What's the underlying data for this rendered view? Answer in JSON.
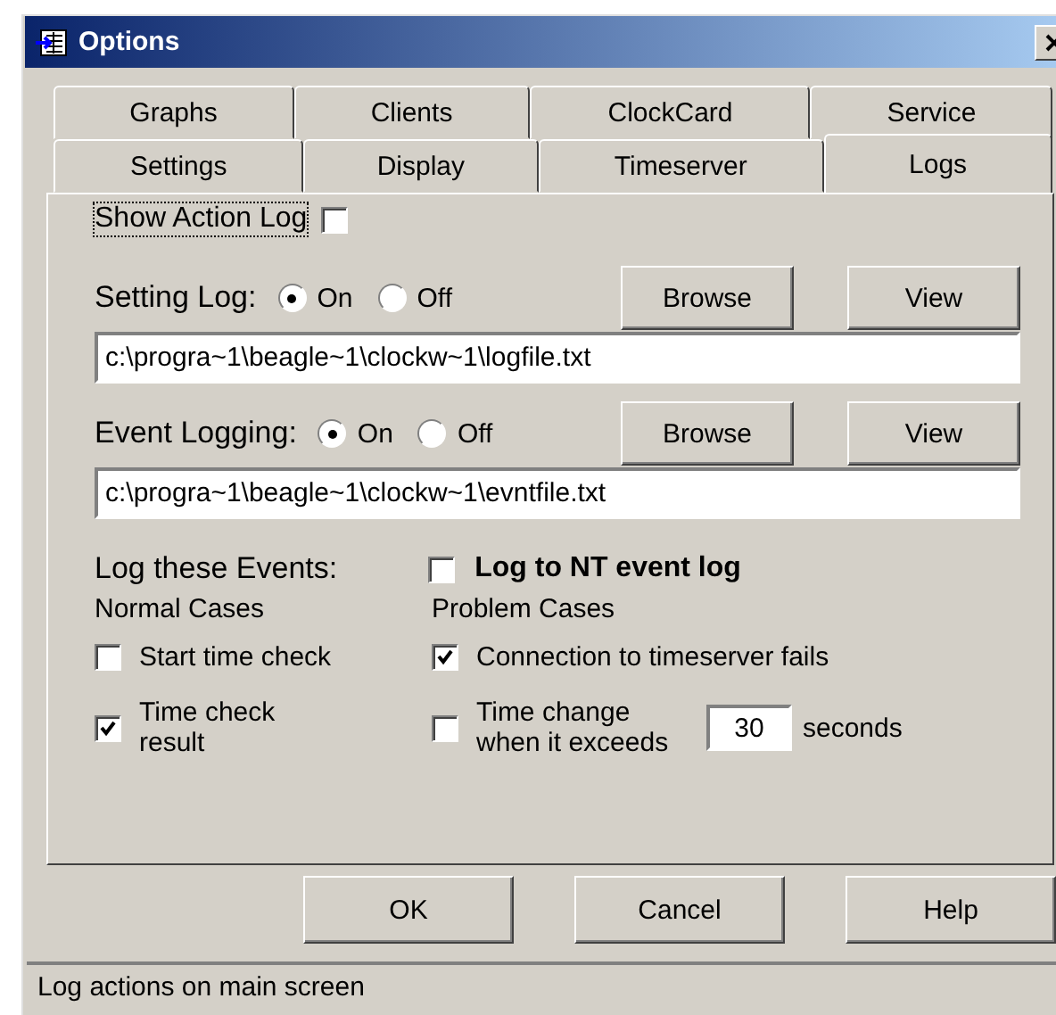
{
  "window": {
    "title": "Options"
  },
  "tabs": {
    "back_row": [
      {
        "label": "Graphs",
        "selected": false
      },
      {
        "label": "Clients",
        "selected": false
      },
      {
        "label": "ClockCard",
        "selected": false
      },
      {
        "label": "Service",
        "selected": false
      }
    ],
    "front_row": [
      {
        "label": "Settings",
        "selected": false
      },
      {
        "label": "Display",
        "selected": false
      },
      {
        "label": "Timeserver",
        "selected": false
      },
      {
        "label": "Logs",
        "selected": true
      }
    ]
  },
  "show_action_log": {
    "label": "Show Action Log",
    "checked": false
  },
  "log_rows": [
    {
      "label": "Setting Log:",
      "options": [
        {
          "label": "On",
          "selected": true
        },
        {
          "label": "Off",
          "selected": false
        }
      ],
      "buttons": [
        "Browse",
        "View"
      ],
      "path": "c:\\progra~1\\beagle~1\\clockw~1\\logfile.txt"
    },
    {
      "label": "Event Logging:",
      "options": [
        {
          "label": "On",
          "selected": true
        },
        {
          "label": "Off",
          "selected": false
        }
      ],
      "buttons": [
        "Browse",
        "View"
      ],
      "path": "c:\\progra~1\\beagle~1\\clockw~1\\evntfile.txt"
    }
  ],
  "events": {
    "title": "Log these Events:",
    "nt_log": {
      "label": "Log to NT event log",
      "checked": false
    },
    "normal_cases": {
      "title": "Normal Cases",
      "items": [
        {
          "label": "Start time check",
          "checked": false
        },
        {
          "label": "Time check result",
          "checked": true
        }
      ]
    },
    "problem_cases": {
      "title": "Problem Cases",
      "items": [
        {
          "label": "Connection to timeserver fails",
          "checked": true
        },
        {
          "label": "Time change when it exceeds",
          "checked": false,
          "value": "30",
          "suffix": "seconds"
        }
      ]
    }
  },
  "buttons": [
    "OK",
    "Cancel",
    "Help"
  ],
  "status_bar": "Log actions on main screen"
}
